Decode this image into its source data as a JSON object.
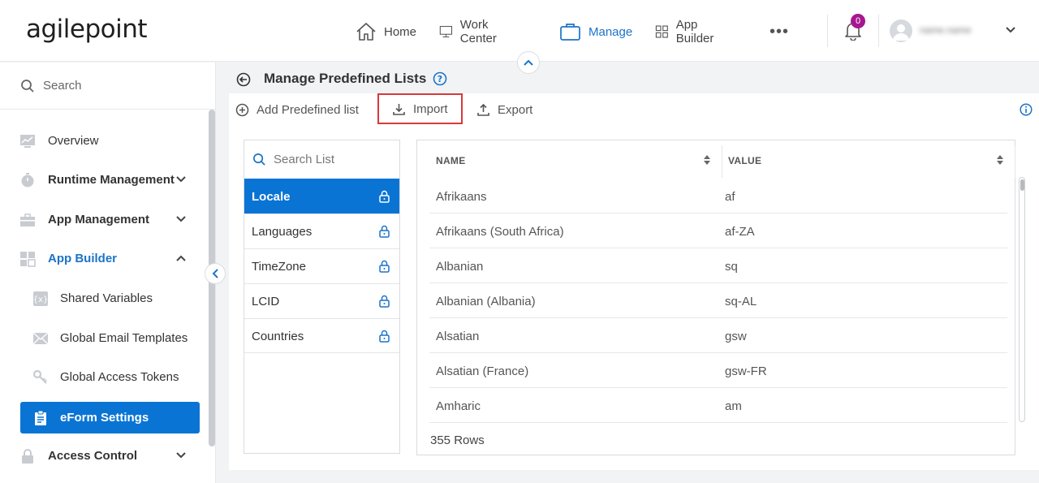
{
  "brand": {
    "logo_text": "agilepoint",
    "accent": "#1b74c7",
    "selected_bg": "#0a74d4",
    "badge_color": "#a7178f"
  },
  "nav": {
    "items": [
      {
        "label": "Home",
        "icon": "home-icon"
      },
      {
        "label": "Work Center",
        "icon": "monitor-icon"
      },
      {
        "label": "Manage",
        "icon": "briefcase-icon",
        "active": true
      },
      {
        "label": "App Builder",
        "icon": "grid-icon"
      }
    ],
    "more": "•••",
    "notification_count": "0",
    "username": "name.name"
  },
  "sidebar": {
    "search_label": "Search",
    "items": [
      {
        "label": "Overview",
        "icon": "chart-icon"
      },
      {
        "label": "Runtime Management",
        "icon": "stopwatch-icon"
      },
      {
        "label": "App Management",
        "icon": "toolbox-icon"
      },
      {
        "label": "App Builder",
        "icon": "grid-icon"
      },
      {
        "label": "Shared Variables",
        "icon": "variable-icon"
      },
      {
        "label": "Global Email Templates",
        "icon": "envelope-icon"
      },
      {
        "label": "Global Access Tokens",
        "icon": "key-icon"
      },
      {
        "label": "eForm Settings",
        "icon": "clipboard-icon"
      },
      {
        "label": "Access Control",
        "icon": "lock-icon"
      }
    ]
  },
  "page": {
    "title": "Manage Predefined Lists",
    "toolbar": {
      "add": "Add Predefined list",
      "import": "Import",
      "export": "Export"
    }
  },
  "lists": {
    "search_placeholder": "Search List",
    "items": [
      "Locale",
      "Languages",
      "TimeZone",
      "LCID",
      "Countries"
    ]
  },
  "grid": {
    "columns": [
      "NAME",
      "VALUE"
    ],
    "rows": [
      [
        "Afrikaans",
        "af"
      ],
      [
        "Afrikaans (South Africa)",
        "af-ZA"
      ],
      [
        "Albanian",
        "sq"
      ],
      [
        "Albanian (Albania)",
        "sq-AL"
      ],
      [
        "Alsatian",
        "gsw"
      ],
      [
        "Alsatian (France)",
        "gsw-FR"
      ],
      [
        "Amharic",
        "am"
      ]
    ],
    "row_count": "355 Rows"
  }
}
